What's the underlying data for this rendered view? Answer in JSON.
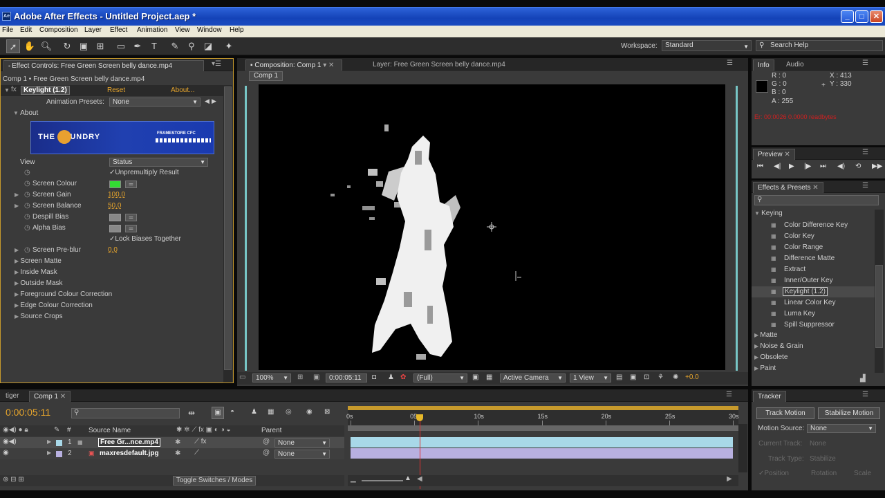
{
  "window": {
    "icon": "Ae",
    "title": "Adobe After Effects - Untitled Project.aep *",
    "controls": [
      "_",
      "□",
      "✕"
    ]
  },
  "menu": [
    "File",
    "Edit",
    "Composition",
    "Layer",
    "Effect",
    "Animation",
    "View",
    "Window",
    "Help"
  ],
  "toolbar": {
    "workspace_label": "Workspace:",
    "workspace_value": "Standard",
    "search_placeholder": "Search Help"
  },
  "effect_controls": {
    "tab_label": "Effect Controls: Free Green Screen belly dance.mp4",
    "breadcrumb": "Comp 1 • Free Green Screen belly dance.mp4",
    "effect_name": "Keylight (1.2)",
    "reset_label": "Reset",
    "about_link": "About...",
    "presets_label": "Animation Presets:",
    "presets_value": "None",
    "about_label": "About",
    "banner_text": "THE FOUNDRY",
    "banner_sub": "FRAMESTORE CFC",
    "view_label": "View",
    "view_value": "Status",
    "unpremultiply_label": "Unpremultiply Result",
    "screen_colour_label": "Screen Colour",
    "screen_colour": "#33dd33",
    "screen_gain_label": "Screen Gain",
    "screen_gain_value": "100.0",
    "screen_balance_label": "Screen Balance",
    "screen_balance_value": "50.0",
    "despill_label": "Despill Bias",
    "alpha_label": "Alpha Bias",
    "lock_biases_label": "Lock Biases Together",
    "preblur_label": "Screen Pre-blur",
    "preblur_value": "0.0",
    "groups": [
      "Screen Matte",
      "Inside Mask",
      "Outside Mask",
      "Foreground Colour Correction",
      "Edge Colour Correction",
      "Source Crops"
    ]
  },
  "composition": {
    "tab_label": "Composition: Comp 1",
    "layer_tab_label": "Layer: Free Green Screen belly dance.mp4",
    "subtab": "Comp 1",
    "zoom": "100%",
    "timecode": "0:00:05:11",
    "resolution": "(Full)",
    "camera": "Active Camera",
    "views": "1 View",
    "exposure": "+0.0"
  },
  "info": {
    "tab_info": "Info",
    "tab_audio": "Audio",
    "r": "R : 0",
    "g": "G : 0",
    "b": "B : 0",
    "a": "A : 255",
    "x": "X : 413",
    "y": "Y : 330",
    "status": "Er: 00:0026 0.0000 readbytes"
  },
  "preview": {
    "tab_label": "Preview"
  },
  "effects_presets": {
    "tab_label": "Effects & Presets",
    "search_placeholder": "",
    "category": "Keying",
    "items": [
      "Color Difference Key",
      "Color Key",
      "Color Range",
      "Difference Matte",
      "Extract",
      "Inner/Outer Key",
      "Keylight (1.2)",
      "Linear Color Key",
      "Luma Key",
      "Spill Suppressor"
    ],
    "selected_item": "Keylight (1.2)",
    "other_categories": [
      "Matte",
      "Noise & Grain",
      "Obsolete",
      "Paint"
    ]
  },
  "timeline": {
    "tab_tiger": "tiger",
    "tab_comp": "Comp 1",
    "timecode": "0:00:05:11",
    "search_placeholder": "",
    "col_num": "#",
    "col_source": "Source Name",
    "col_parent": "Parent",
    "layers": [
      {
        "num": "1",
        "name": "Free Gr...nce.mp4",
        "parent": "None",
        "color": "#a8d8e8"
      },
      {
        "num": "2",
        "name": "maxresdefault.jpg",
        "parent": "None",
        "color": "#b8b0e0"
      }
    ],
    "ruler": [
      "0s",
      "05s",
      "10s",
      "15s",
      "20s",
      "25s",
      "30s"
    ],
    "playhead_fraction": 0.18,
    "toggle_label": "Toggle Switches / Modes"
  },
  "tracker": {
    "tab_label": "Tracker",
    "track_motion": "Track Motion",
    "stabilize_motion": "Stabilize Motion",
    "motion_source_label": "Motion Source:",
    "motion_source_value": "None",
    "current_track_label": "Current Track:",
    "current_track_value": "None",
    "track_type_label": "Track Type:",
    "track_type_value": "Stabilize",
    "position_label": "Position",
    "rotation_label": "Rotation",
    "scale_label": "Scale"
  }
}
